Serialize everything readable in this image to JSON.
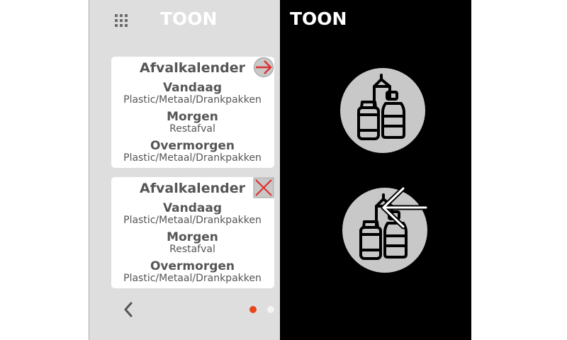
{
  "left_panel": {
    "logo": "TOON",
    "cards": [
      {
        "title": "Afvalkalender",
        "rows": [
          {
            "day": "Vandaag",
            "waste": "Plastic/Metaal/Drankpakken"
          },
          {
            "day": "Morgen",
            "waste": "Restafval"
          },
          {
            "day": "Overmorgen",
            "waste": "Plastic/Metaal/Drankpakken"
          }
        ]
      },
      {
        "title": "Afvalkalender",
        "rows": [
          {
            "day": "Vandaag",
            "waste": "Plastic/Metaal/Drankpakken"
          },
          {
            "day": "Morgen",
            "waste": "Restafval"
          },
          {
            "day": "Overmorgen",
            "waste": "Plastic/Metaal/Drankpakken"
          }
        ]
      }
    ],
    "pagination": {
      "current_page": 1,
      "total_pages": 2,
      "active_color": "#e5461c"
    }
  },
  "right_panel": {
    "logo": "TOON"
  },
  "colors": {
    "panel_light": "#dedede",
    "panel_dark": "#000000",
    "card": "#ffffff",
    "text": "#555555",
    "accent_red": "#e03030",
    "icon_circle": "#c8c8c8"
  },
  "icons": {
    "apps": "grid-icon",
    "card_1_action": "arrow-right-icon",
    "card_2_action": "close-icon",
    "back": "chevron-left-icon",
    "waste": "plastic-bottles-icon",
    "overlay": "arrow-left-icon"
  }
}
